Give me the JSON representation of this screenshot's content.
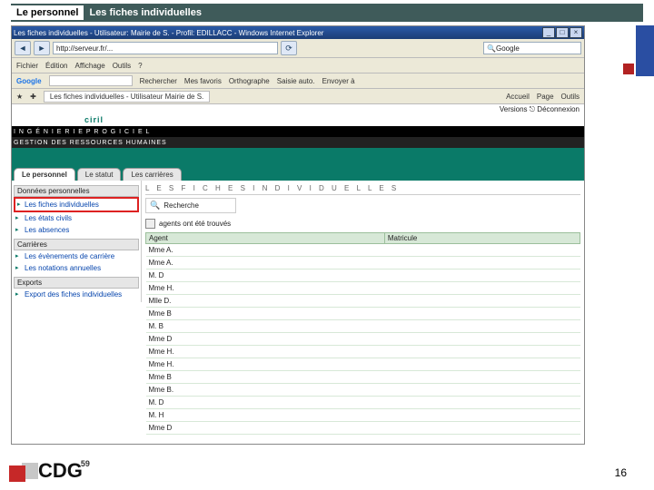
{
  "slide": {
    "title_white": "Le personnel",
    "title_green": " Les fiches individuelles",
    "page_number": "16",
    "footer_logo_text": "CDG",
    "footer_logo_sup": "59"
  },
  "ie": {
    "window_title": "Les fiches individuelles - Utilisateur: Mairie de S.       - Profil: EDILLACC - Windows Internet Explorer",
    "url": "http://serveur.fr/...",
    "refresh_glyph": "⟳",
    "search_placeholder": "Google",
    "search_glyph": "🔍",
    "menubar": [
      "Fichier",
      "Édition",
      "Affichage",
      "Outils",
      "?"
    ],
    "google_bar": {
      "label": "Google",
      "items": [
        "Rechercher",
        "",
        "Mes favoris",
        "Orthographe",
        "Saisie auto.",
        "Envoyer à"
      ]
    },
    "favbar": {
      "tab": "Les fiches individuelles - Utilisateur Mairie de S.",
      "right": [
        "Accueil",
        "Page",
        "Outils"
      ]
    },
    "versions": "Versions ⎋ Déconnexion"
  },
  "app": {
    "brand": "ciril",
    "band1": "I N G É N I E R I E   P R O G I C I E L",
    "band2": "GESTION DES RESSOURCES HUMAINES",
    "tabs": [
      "Le personnel",
      "Le statut",
      "Les carrières"
    ],
    "active_tab": 0,
    "breadcrumb": "L E S   F I C H E S   I N D I V I D U E L L E S",
    "search_label": "Recherche",
    "found_text": "agents ont été trouvés",
    "sidebar": {
      "donnees": {
        "header": "Données personnelles",
        "items": [
          "Les fiches individuelles",
          "Les états civils",
          "Les absences"
        ]
      },
      "carrieres": {
        "header": "Carrières",
        "items": [
          "Les évènements de carrière",
          "Les notations annuelles"
        ]
      },
      "editions": {
        "header": "Exports",
        "items": [
          "Export des fiches individuelles"
        ]
      }
    },
    "table": {
      "cols": [
        "Agent",
        "Matricule"
      ],
      "rows": [
        [
          "Mme A.",
          ""
        ],
        [
          "Mme A.",
          ""
        ],
        [
          "M. D",
          ""
        ],
        [
          "Mme H.",
          ""
        ],
        [
          "Mlle D.",
          ""
        ],
        [
          "Mme B",
          ""
        ],
        [
          "M. B",
          ""
        ],
        [
          "Mme D",
          ""
        ],
        [
          "Mme H.",
          ""
        ],
        [
          "Mme H.",
          ""
        ],
        [
          "Mme B",
          ""
        ],
        [
          "Mme B.",
          ""
        ],
        [
          "M. D",
          ""
        ],
        [
          "M. H",
          ""
        ],
        [
          "Mme D",
          ""
        ]
      ]
    }
  }
}
